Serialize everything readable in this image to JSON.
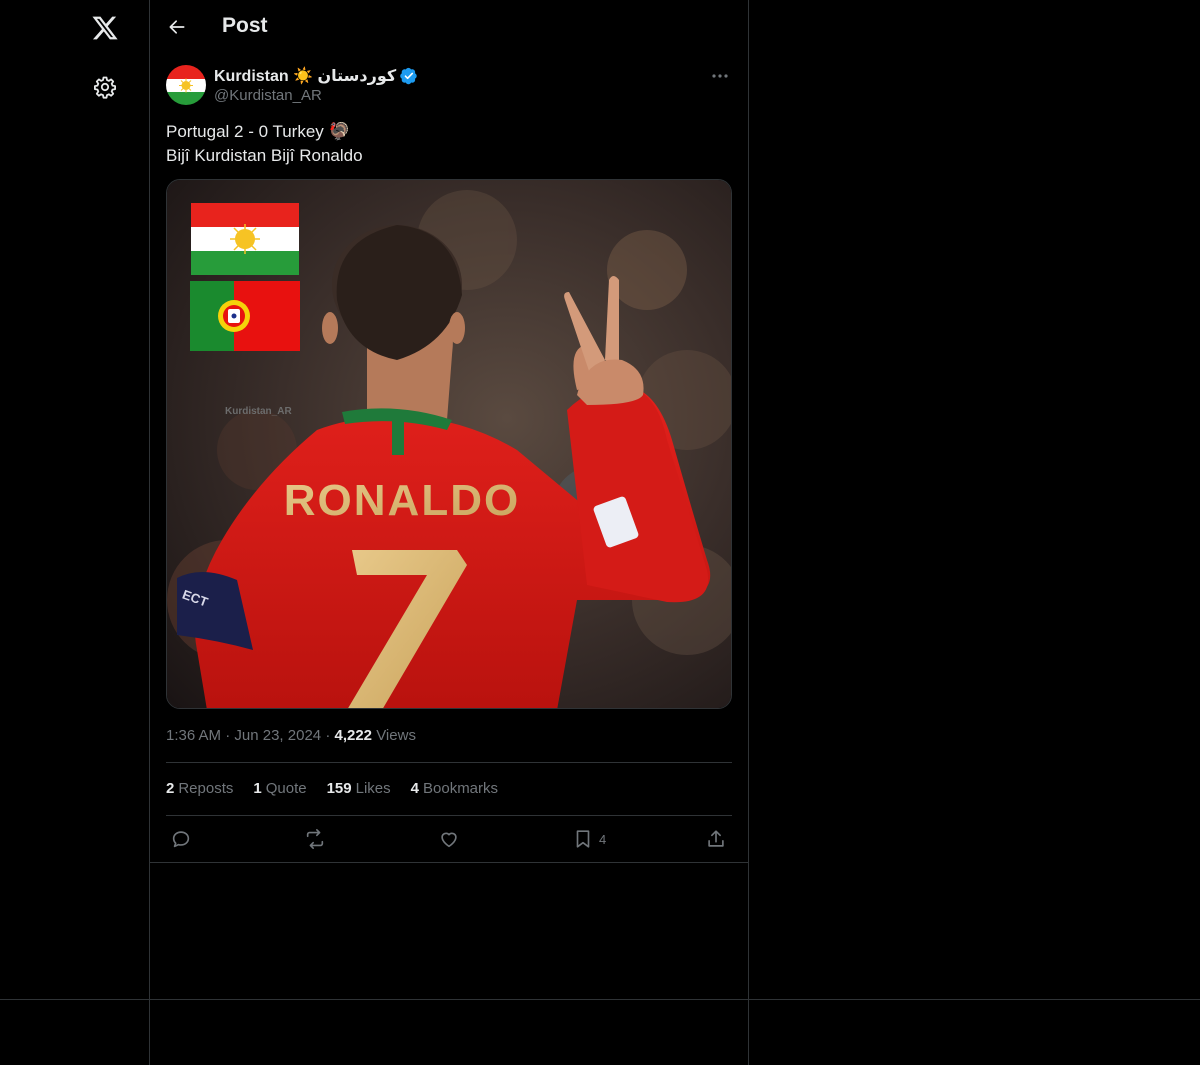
{
  "header": {
    "title": "Post"
  },
  "nav": {
    "logo_icon": "x-logo-icon",
    "settings_icon": "gear-icon"
  },
  "post": {
    "author": {
      "display_name": "Kurdistan ☀️ کوردستان",
      "handle": "@Kurdistan_AR",
      "verified": true
    },
    "text_lines": [
      "Portugal 2 - 0 Turkey 🦃",
      "Bijî Kurdistan Bijî Ronaldo"
    ],
    "media": {
      "jersey_name": "RONALDO",
      "jersey_number": "7",
      "watermark": "Kurdistan_AR",
      "armband_text": "ECT"
    },
    "time": "1:36 AM",
    "date": "Jun 23, 2024",
    "views_count": "4,222",
    "views_label": "Views",
    "stats": {
      "reposts_count": "2",
      "reposts_label": "Reposts",
      "quotes_count": "1",
      "quotes_label": "Quote",
      "likes_count": "159",
      "likes_label": "Likes",
      "bookmarks_count": "4",
      "bookmarks_label": "Bookmarks"
    },
    "actions": {
      "bookmark_count": "4"
    }
  },
  "colors": {
    "background": "#000000",
    "text": "#e7e9ea",
    "muted": "#71767b",
    "divider": "#2f3336",
    "verified": "#1d9bf0"
  }
}
